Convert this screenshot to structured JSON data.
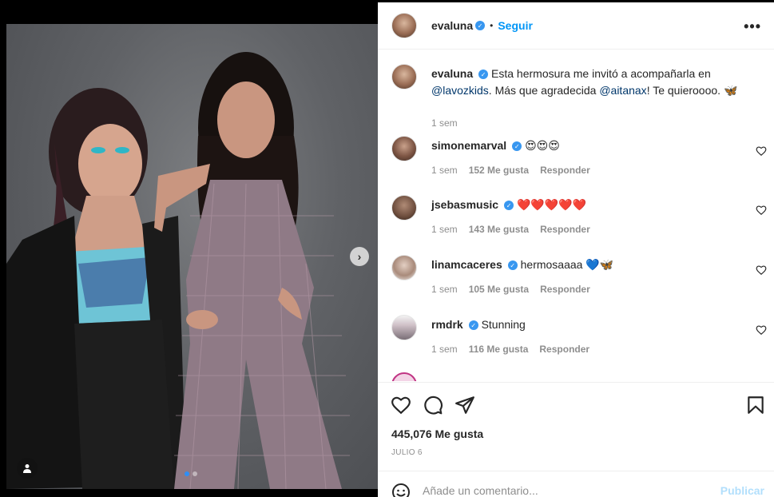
{
  "post": {
    "author": "evaluna",
    "follow_label": "Seguir",
    "separator": "•",
    "more_label": "•••"
  },
  "caption": {
    "username": "evaluna",
    "text_before": "Esta hermosura me invitó a acompañarla en ",
    "mention1": "@lavozkids",
    "text_middle": ". Más que agradecida ",
    "mention2": "@aitanax",
    "text_after": "! Te quieroooo. 🦋",
    "time": "1 sem"
  },
  "comments": [
    {
      "username": "simonemarval",
      "text": "😍😍😍",
      "time": "1 sem",
      "likes": "152 Me gusta",
      "reply": "Responder"
    },
    {
      "username": "jsebasmusic",
      "text": "❤️❤️❤️❤️❤️",
      "time": "1 sem",
      "likes": "143 Me gusta",
      "reply": "Responder"
    },
    {
      "username": "linamcaceres",
      "text": "hermosaaaa 💙🦋",
      "time": "1 sem",
      "likes": "105 Me gusta",
      "reply": "Responder"
    },
    {
      "username": "rmdrk",
      "text": "Stunning",
      "time": "1 sem",
      "likes": "116 Me gusta",
      "reply": "Responder"
    }
  ],
  "stats": {
    "likes": "445,076 Me gusta",
    "date": "JULIO 6"
  },
  "composer": {
    "placeholder": "Añade un comentario...",
    "publish_label": "Publicar"
  },
  "icons": {
    "next": "chevron-right-icon",
    "tag": "user-tag-icon",
    "like": "heart-icon",
    "comment": "comment-icon",
    "share": "paper-plane-icon",
    "save": "bookmark-icon",
    "emoji": "smiley-icon",
    "verified": "verified-badge-icon"
  },
  "colors": {
    "accent": "#0095f6",
    "verified": "#3897f0",
    "publish_disabled": "#b2dffc"
  },
  "carousel": {
    "total": 2,
    "current": 1
  }
}
